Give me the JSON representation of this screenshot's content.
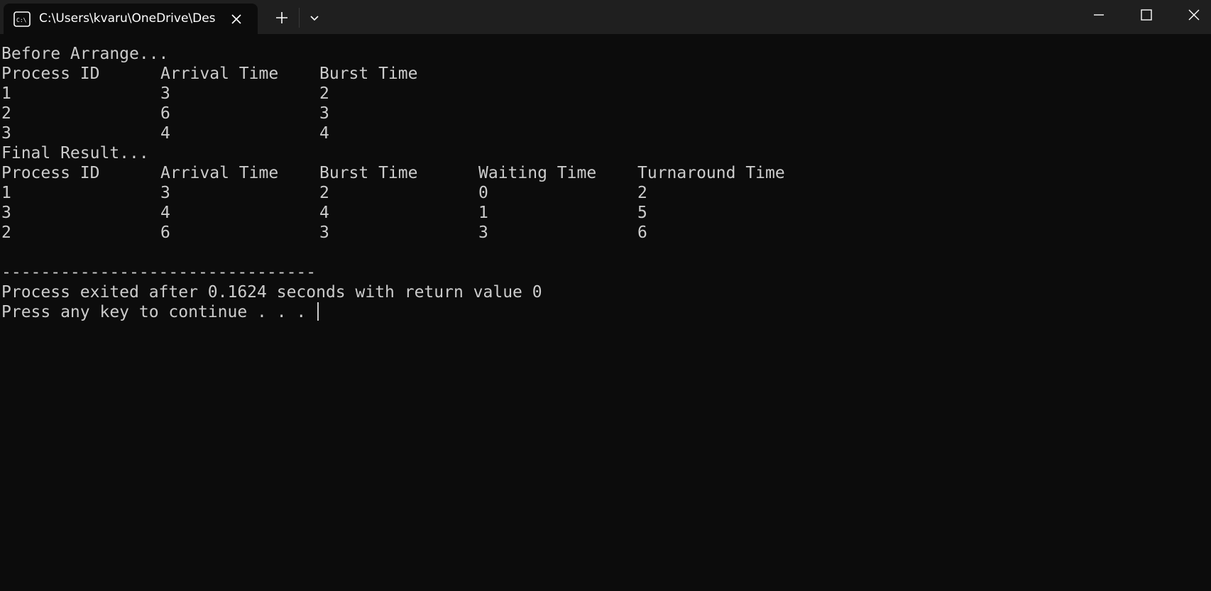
{
  "window": {
    "tab_title": "C:\\Users\\kvaru\\OneDrive\\Des",
    "tab_icon": "terminal-icon",
    "new_tab_icon": "plus-icon",
    "dropdown_icon": "chevron-down-icon",
    "minimize_icon": "minimize-icon",
    "maximize_icon": "maximize-icon",
    "close_icon": "close-icon"
  },
  "output": {
    "before_heading": "Before Arrange...",
    "before_headers": [
      "Process ID",
      "Arrival Time",
      "Burst Time"
    ],
    "before_rows": [
      [
        "1",
        "3",
        "2"
      ],
      [
        "2",
        "6",
        "3"
      ],
      [
        "3",
        "4",
        "4"
      ]
    ],
    "final_heading": "Final Result...",
    "final_headers": [
      "Process ID",
      "Arrival Time",
      "Burst Time",
      "Waiting Time",
      "Turnaround Time"
    ],
    "final_rows": [
      [
        "1",
        "3",
        "2",
        "0",
        "2"
      ],
      [
        "3",
        "4",
        "4",
        "1",
        "5"
      ],
      [
        "2",
        "6",
        "3",
        "3",
        "6"
      ]
    ],
    "separator": "--------------------------------",
    "exit_message": "Process exited after 0.1624 seconds with return value 0",
    "prompt": "Press any key to continue . . . "
  },
  "colors": {
    "background": "#0c0c0c",
    "titlebar": "#1f1f1f",
    "text": "#cccccc"
  }
}
